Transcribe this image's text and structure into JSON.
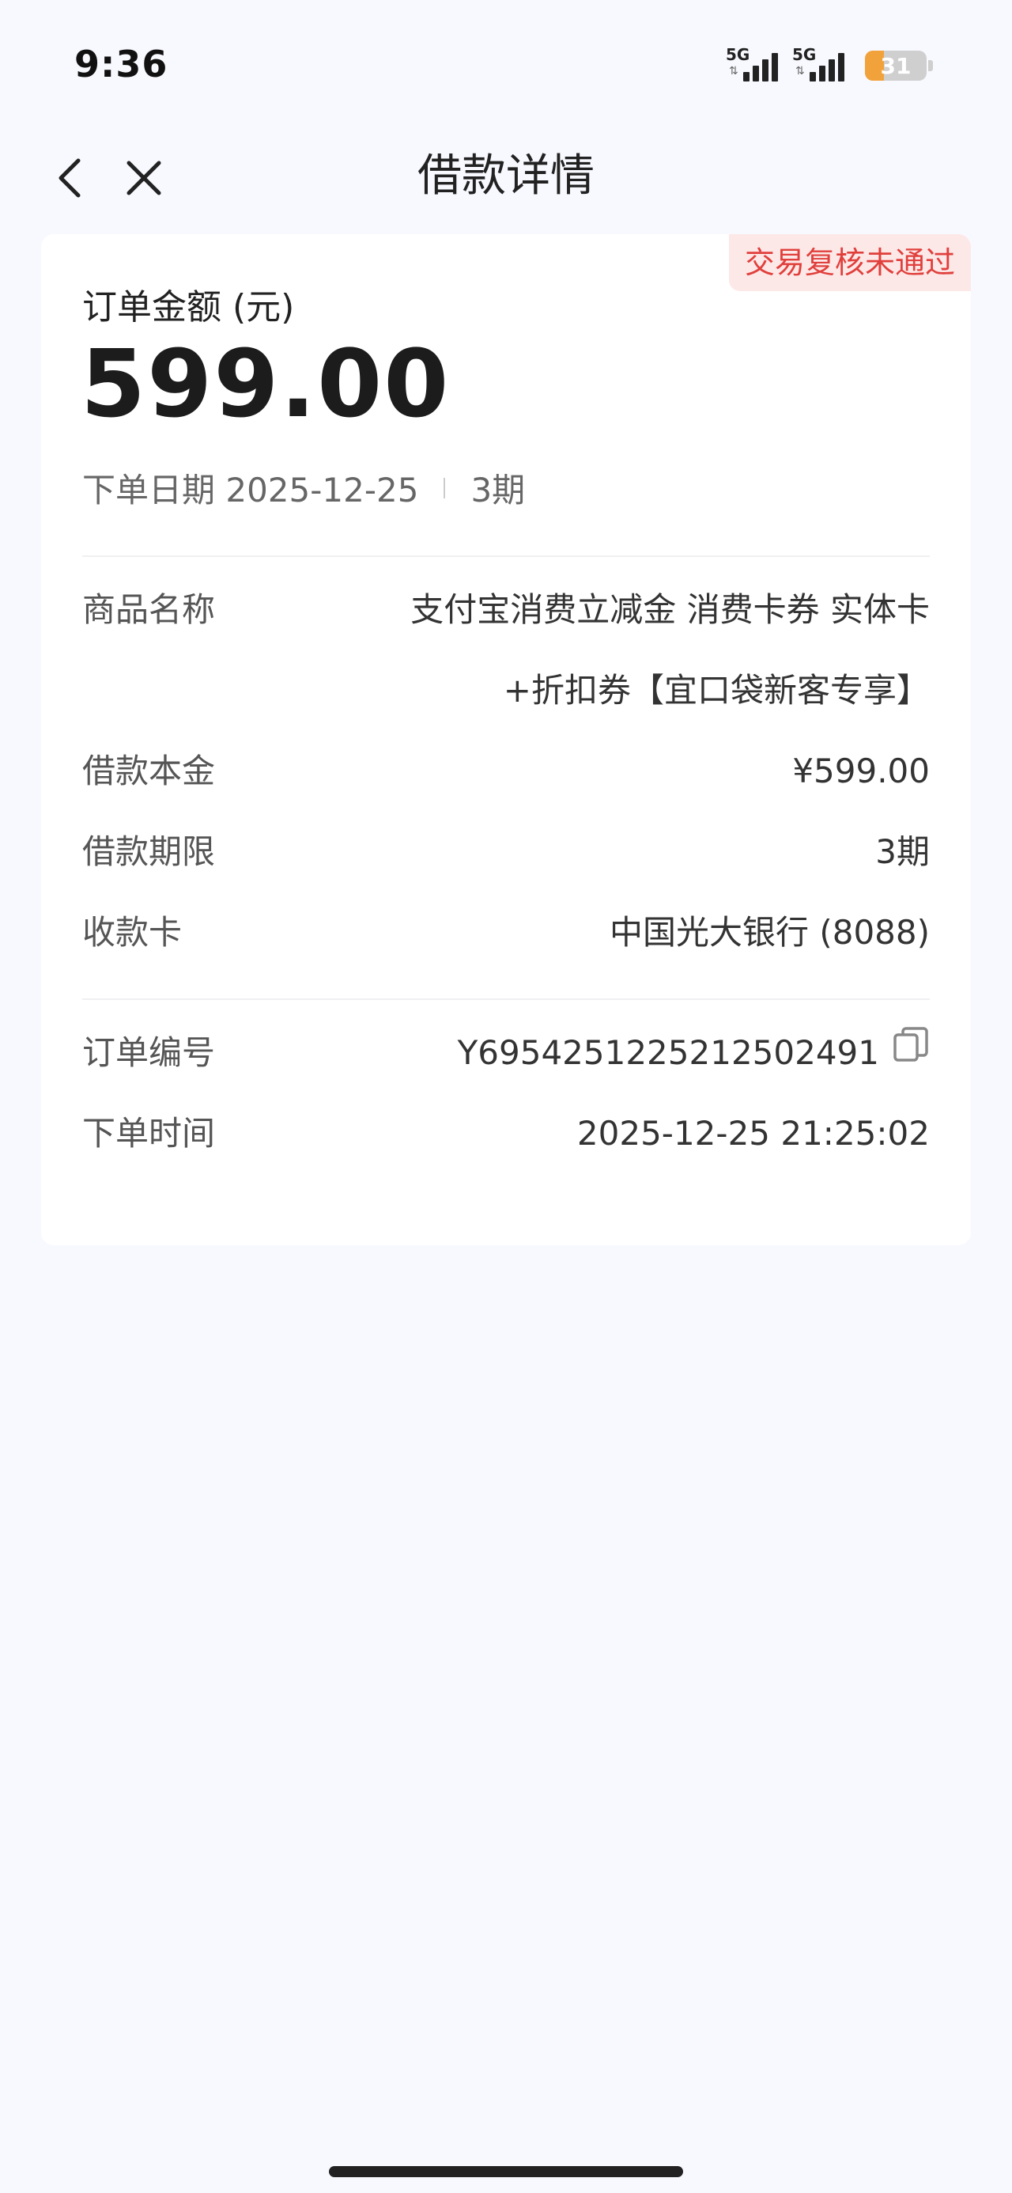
{
  "status_bar": {
    "time": "9:36",
    "signal1_label": "5G",
    "signal2_label": "5G",
    "battery_level": "31",
    "battery_percent": 31,
    "battery_color": "#f2a23a"
  },
  "nav": {
    "title": "借款详情",
    "back_icon": "chevron-left-icon",
    "close_icon": "close-icon"
  },
  "order": {
    "status_badge": "交易复核未通过",
    "amount_label": "订单金额 (元)",
    "amount": "599.00",
    "date_label": "下单日期 2025-12-25",
    "installments": "3期"
  },
  "details": [
    {
      "key": "商品名称",
      "value": "支付宝消费立减金 消费卡券 实体卡+折扣券【宜口袋新客专享】"
    },
    {
      "key": "借款本金",
      "value": "¥599.00"
    },
    {
      "key": "借款期限",
      "value": "3期"
    },
    {
      "key": "收款卡",
      "value": "中国光大银行 (8088)"
    }
  ],
  "meta": [
    {
      "key": "订单编号",
      "value": "Y695425122521250249​1"
    },
    {
      "key": "下单时间",
      "value": "2025-12-25 21:25:02"
    }
  ],
  "colors": {
    "accent_red": "#e0403c",
    "badge_bg": "#fde8e8",
    "page_bg": "#f8f9fe"
  }
}
